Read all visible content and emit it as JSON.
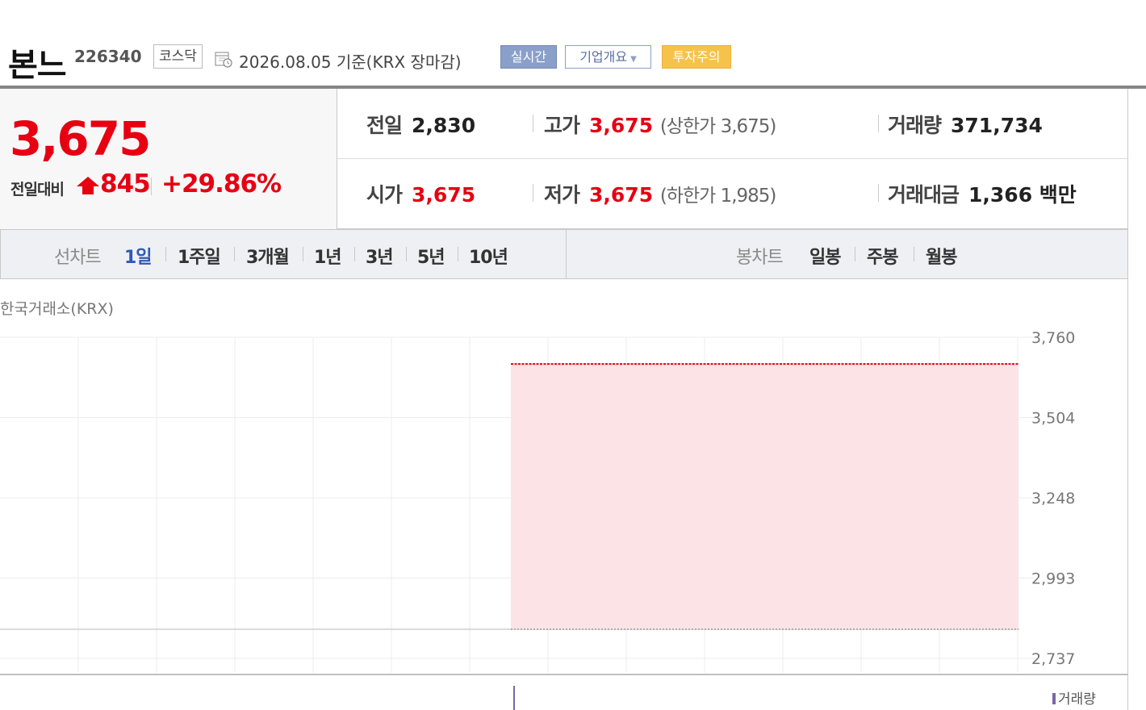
{
  "header": {
    "stock_name": "본느",
    "stock_code": "226340",
    "market": "코스닥",
    "base_date": "2026.08.05  기준(KRX 장마감)",
    "calendar_icon": "calendar-icon",
    "badges": {
      "realtime": "실시간",
      "company_info": "기업개요",
      "warning": "투자주의"
    },
    "colors": {
      "realtime": "#8a9fc9",
      "warning": "#f6c34a"
    }
  },
  "quote": {
    "current_price": "3,675",
    "change_label": "전일대비",
    "change_icon": "arrow-up-icon",
    "change_amount": "845",
    "change_percent": "+29.86%",
    "prev_close": {
      "label": "전일",
      "value": "2,830"
    },
    "open": {
      "label": "시가",
      "value": "3,675"
    },
    "high": {
      "label": "고가",
      "value": "3,675",
      "limit_text": "(상한가 3,675)"
    },
    "low": {
      "label": "저가",
      "value": "3,675",
      "limit_text": "(하한가 1,985)"
    },
    "volume": {
      "label": "거래량",
      "value": "371,734"
    },
    "amount": {
      "label": "거래대금",
      "value": "1,366 백만"
    },
    "up_color": "#e60012"
  },
  "tabs": {
    "line_chart_label": "선차트",
    "line_periods": [
      "1일",
      "1주일",
      "3개월",
      "1년",
      "3년",
      "5년",
      "10년"
    ],
    "active_period": "1일",
    "candle_chart_label": "봉차트",
    "candle_periods": [
      "일봉",
      "주봉",
      "월봉"
    ]
  },
  "chart_data": {
    "type": "area",
    "exchange_label": "한국거래소(KRX)",
    "y_ticks": [
      "3,760",
      "3,504",
      "3,248",
      "2,993",
      "2,737"
    ],
    "ylim": [
      2737,
      3760
    ],
    "x_start_fraction": 0.5,
    "x_end_fraction": 0.94,
    "value": 3675,
    "baseline": 2830,
    "fill_color": "#fce4e6",
    "line_color": "#e60012",
    "volume_legend": "거래량"
  }
}
